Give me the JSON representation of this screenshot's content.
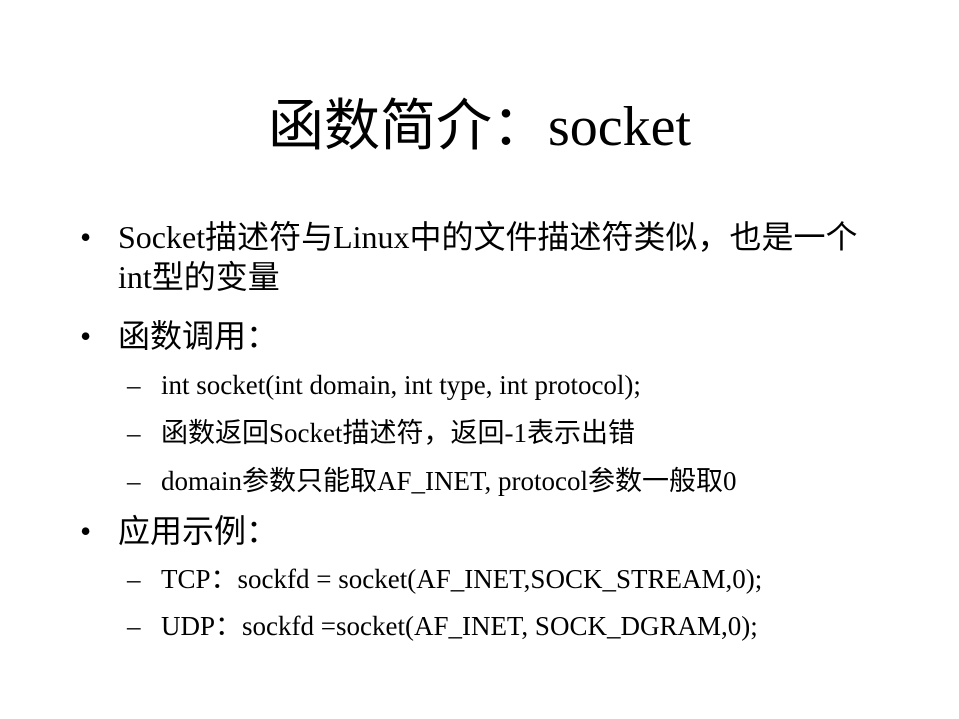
{
  "slide": {
    "title": "函数简介：socket",
    "bullet_symbol": "•",
    "dash_symbol": "–",
    "bullets": [
      {
        "text": "Socket描述符与Linux中的文件描述符类似，也是一个int型的变量"
      },
      {
        "text": "函数调用：",
        "subitems": [
          "int socket(int domain, int type, int protocol);",
          "函数返回Socket描述符，返回-1表示出错",
          "domain参数只能取AF_INET, protocol参数一般取0"
        ]
      },
      {
        "text": "应用示例：",
        "subitems": [
          "TCP：sockfd = socket(AF_INET,SOCK_STREAM,0);",
          "UDP：sockfd =socket(AF_INET, SOCK_DGRAM,0);"
        ]
      }
    ]
  }
}
